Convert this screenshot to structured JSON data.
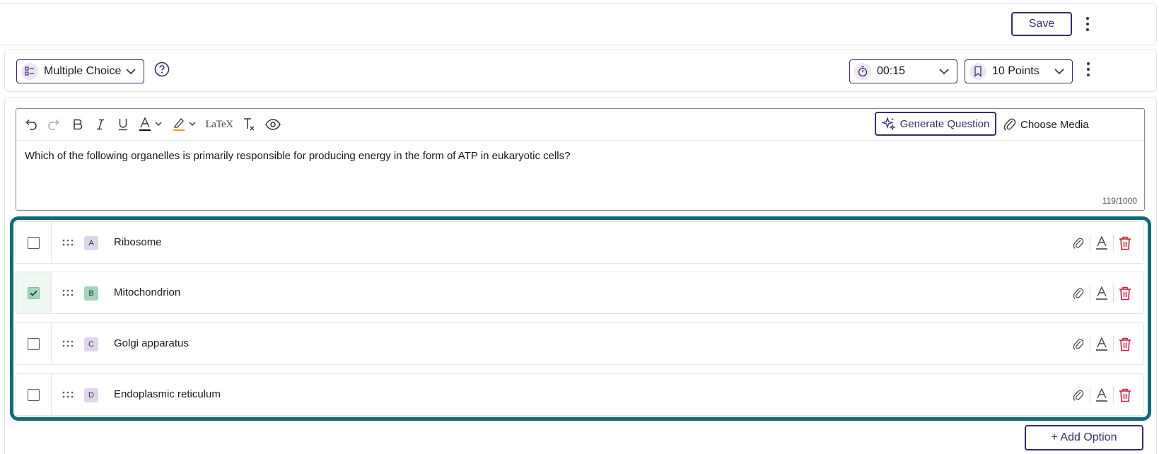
{
  "header": {
    "save_label": "Save"
  },
  "settings": {
    "question_type": "Multiple Choice",
    "timer": "00:15",
    "points": "10 Points"
  },
  "editor": {
    "toolbar": {
      "generate_label": "Generate Question",
      "media_label": "Choose Media",
      "latex_label": "LaTeX"
    },
    "question_text": "Which of the following organelles is primarily responsible for producing energy in the form of ATP in eukaryotic cells?",
    "char_count": "119/1000"
  },
  "options": [
    {
      "letter": "A",
      "text": "Ribosome",
      "correct": false
    },
    {
      "letter": "B",
      "text": "Mitochondrion",
      "correct": true
    },
    {
      "letter": "C",
      "text": "Golgi apparatus",
      "correct": false
    },
    {
      "letter": "D",
      "text": "Endoplasmic reticulum",
      "correct": false
    }
  ],
  "add_option_label": "+ Add Option",
  "colors": {
    "brand": "#3b2a6b",
    "highlight_frame": "#0f6b77",
    "correct_fill": "#9fd5ba",
    "letter_fill": "#ddd6ee",
    "delete": "#c8203a"
  }
}
